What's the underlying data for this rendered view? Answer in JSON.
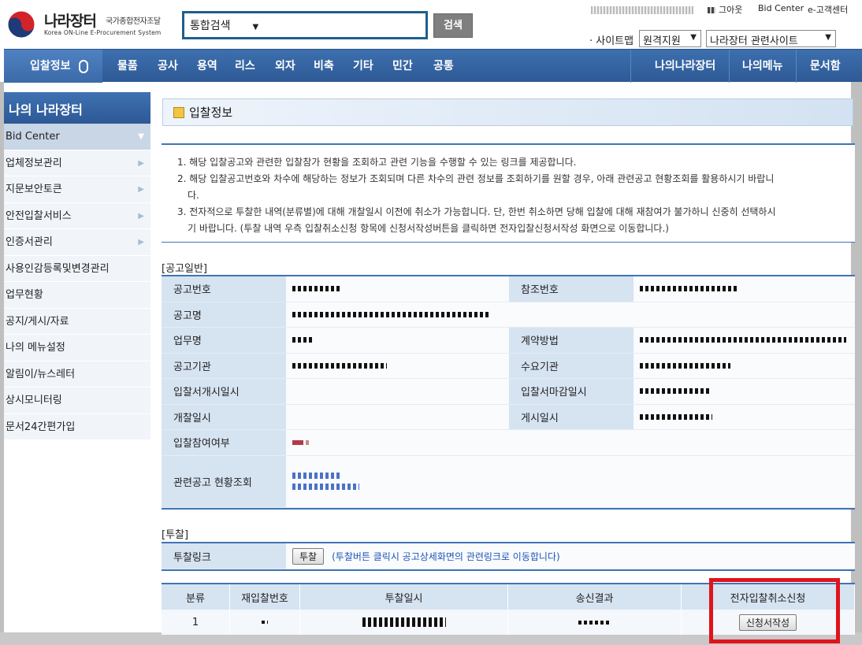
{
  "header": {
    "logo_title": "나라장터",
    "logo_subtitle": "국가종합전자조달",
    "logo_english": "Korea ON-Line E-Procurement System",
    "search_select": "통합검색",
    "search_button": "검색",
    "top_links": [
      "그아웃",
      "Bid Center",
      "e-고객센터"
    ],
    "sitemap_label": "· 사이트맵",
    "select_region": "원격지원",
    "select_related": "나라장터 관련사이트"
  },
  "nav": {
    "items": [
      "입찰정보",
      "물품",
      "공사",
      "용역",
      "리스",
      "외자",
      "비축",
      "기타",
      "민간",
      "공통"
    ],
    "right_items": [
      "나의나라장터",
      "나의메뉴",
      "문서함"
    ]
  },
  "sidebar": {
    "title": "나의 나라장터",
    "items": [
      {
        "label": "Bid Center"
      },
      {
        "label": "업체정보관리"
      },
      {
        "label": "지문보안토큰"
      },
      {
        "label": "안전입찰서비스"
      },
      {
        "label": "인증서관리"
      },
      {
        "label": "사용인감등록및변경관리"
      },
      {
        "label": "업무현황"
      },
      {
        "label": "공지/게시/자료"
      },
      {
        "label": "나의 메뉴설정"
      },
      {
        "label": "알림이/뉴스레터"
      },
      {
        "label": "상시모니터링"
      },
      {
        "label": "문서24간편가입"
      }
    ]
  },
  "page": {
    "title": "입찰정보",
    "notices": [
      "1. 해당 입찰공고와 관련한 입찰참가 현황을 조회하고 관련 기능을 수행할 수 있는 링크를 제공합니다.",
      "2. 해당 입찰공고번호와 차수에 해당하는 정보가 조회되며 다른 차수의 관련 정보를 조회하기를 원할 경우, 아래 관련공고 현황조회를 활용하시기 바랍니",
      "다.",
      "3. 전자적으로 투찰한 내역(분류별)에 대해 개찰일시 이전에 취소가 가능합니다. 단, 한번 취소하면 당해 입찰에 대해 재참여가 불가하니 신중히 선택하시",
      "기 바랍니다. (투찰 내역 우측 입찰취소신청 항목에 신청서작성버튼을 클릭하면 전자입찰신청서작성 화면으로 이동합니다.)"
    ]
  },
  "general": {
    "section": "[공고일반]",
    "labels": {
      "notice_no": "공고번호",
      "ref_no": "참조번호",
      "notice_name": "공고명",
      "task_name": "업무명",
      "contract_method": "계약방법",
      "notice_org": "공고기관",
      "demand_org": "수요기관",
      "bid_open_start": "입찰서개시일시",
      "bid_close": "입찰서마감일시",
      "opening": "개찰일시",
      "posting": "게시일시",
      "participation": "입찰참여여부",
      "related_lookup": "관련공고 현황조회"
    }
  },
  "bid": {
    "section": "[투찰]",
    "link_label": "투찰링크",
    "link_button": "투찰",
    "link_note": "(투찰버튼 클릭시 공고상세화면의 관련링크로 이동합니다)",
    "columns": [
      "분류",
      "재입찰번호",
      "투찰일시",
      "송신결과",
      "전자입찰취소신청"
    ],
    "rows": [
      {
        "category": "1",
        "action": "신청서작성"
      }
    ]
  }
}
